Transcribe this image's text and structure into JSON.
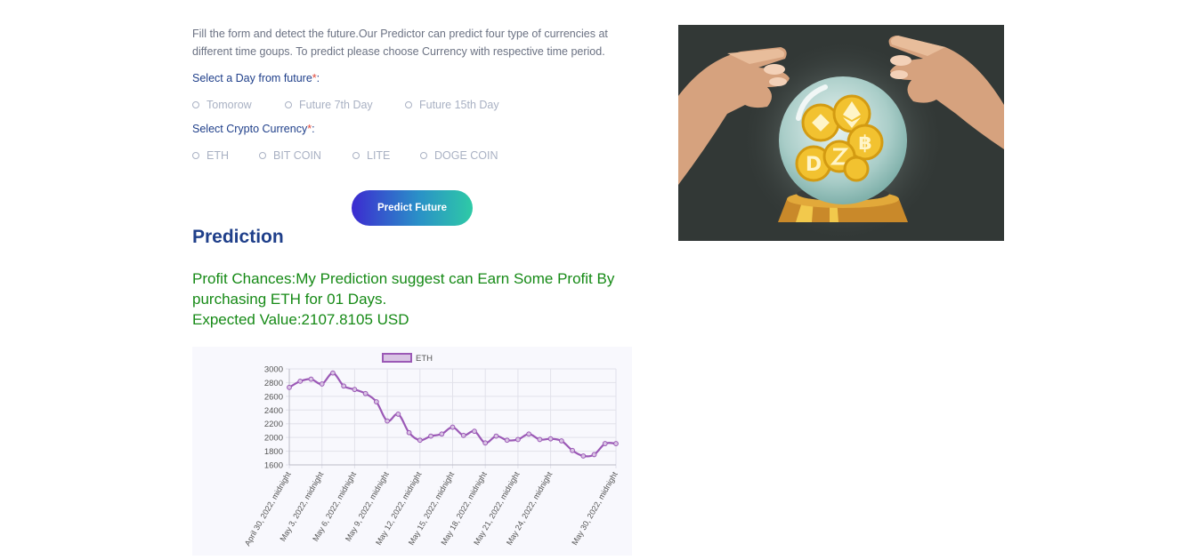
{
  "intro_text": "Fill the form and detect the future.Our Predictor can predict four type of currencies at different time goups. To predict please choose Currency with respective time period.",
  "day_field": {
    "label": "Select a Day from future",
    "required_mark": "*",
    "suffix": ":",
    "options": [
      "Tomorow",
      "Future 7th Day",
      "Future 15th Day"
    ]
  },
  "currency_field": {
    "label": "Select Crypto Currency",
    "required_mark": "*",
    "suffix": ":",
    "options": [
      "ETH",
      "BIT COIN",
      "LITE",
      "DOGE COIN"
    ]
  },
  "predict_button": {
    "label": "Predict Future"
  },
  "prediction": {
    "heading": "Prediction",
    "line1": "Profit Chances:My Prediction suggest can Earn Some Profit By purchasing ETH for 01 Days.",
    "line2": "Expected Value:2107.8105 USD"
  },
  "colors": {
    "accent_blue": "#1f3f8a",
    "profit_green": "#168a16",
    "series_line": "#9b59b6"
  },
  "chart_data": {
    "type": "line",
    "legend_placement": "top-center",
    "grid": true,
    "ylim": [
      1600,
      3000
    ],
    "yticks": [
      1600,
      1800,
      2000,
      2200,
      2400,
      2600,
      2800,
      3000
    ],
    "xtick_labels": [
      "April 30, 2022, midnight",
      "May 3, 2022, midnight",
      "May 6, 2022, midnight",
      "May 9, 2022, midnight",
      "May 12, 2022, midnight",
      "May 15, 2022, midnight",
      "May 18, 2022, midnight",
      "May 21, 2022, midnight",
      "May 24, 2022, midnight",
      "May 30, 2022, midnight"
    ],
    "series": [
      {
        "name": "ETH",
        "x": [
          "2022-04-30",
          "2022-05-01",
          "2022-05-02",
          "2022-05-03",
          "2022-05-04",
          "2022-05-05",
          "2022-05-06",
          "2022-05-07",
          "2022-05-08",
          "2022-05-09",
          "2022-05-10",
          "2022-05-11",
          "2022-05-12",
          "2022-05-13",
          "2022-05-14",
          "2022-05-15",
          "2022-05-16",
          "2022-05-17",
          "2022-05-18",
          "2022-05-19",
          "2022-05-20",
          "2022-05-21",
          "2022-05-22",
          "2022-05-23",
          "2022-05-24",
          "2022-05-25",
          "2022-05-26",
          "2022-05-27",
          "2022-05-28",
          "2022-05-29",
          "2022-05-30"
        ],
        "values": [
          2730,
          2820,
          2850,
          2780,
          2940,
          2750,
          2700,
          2640,
          2520,
          2240,
          2340,
          2070,
          1960,
          2020,
          2050,
          2150,
          2030,
          2090,
          1920,
          2020,
          1960,
          1970,
          2050,
          1970,
          1980,
          1950,
          1810,
          1730,
          1750,
          1910,
          1910
        ]
      }
    ]
  }
}
